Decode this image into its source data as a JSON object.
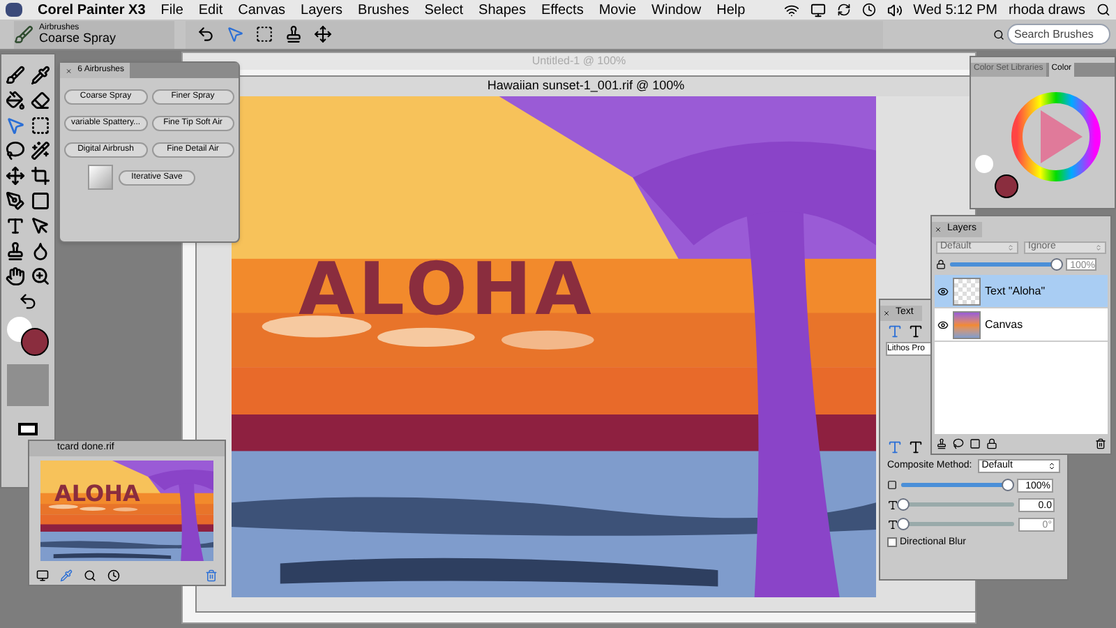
{
  "menu_bar": {
    "app_name": "Corel Painter X3",
    "menus": [
      "File",
      "Edit",
      "Canvas",
      "Layers",
      "Brushes",
      "Select",
      "Shapes",
      "Effects",
      "Movie",
      "Window",
      "Help"
    ],
    "clock": "Wed 5:12 PM",
    "user": "rhoda draws"
  },
  "property_bar": {
    "brush_category": "Airbrushes",
    "brush_variant": "Coarse Spray",
    "search": {
      "placeholder": "Search Brushes"
    }
  },
  "background_document": {
    "title": "Untitled-1 @ 100%"
  },
  "document": {
    "title": "Hawaiian sunset-1_001.rif @ 100%",
    "artwork_text": "ALOHA"
  },
  "brush_panel": {
    "title": "6 Airbrushes",
    "variants": [
      "Coarse Spray",
      "Finer Spray",
      "variable Spattery...",
      "Fine Tip Soft Air",
      "Digital Airbrush",
      "Fine Detail Air"
    ],
    "iterative_save": "Iterative Save"
  },
  "navigator": {
    "title": "tcard done.rif",
    "thumbnail_text": "ALOHA"
  },
  "color_panel": {
    "tabs": [
      {
        "label": "Color Set Libraries",
        "selected": false
      },
      {
        "label": "Color",
        "selected": true
      }
    ]
  },
  "layers_panel": {
    "title": "Layers",
    "composite_method": "Default",
    "composite_depth": "Ignore",
    "opacity": {
      "level": 0.95,
      "reading": "100%"
    },
    "layers": [
      {
        "name": "Text \"Aloha\"",
        "kind": "text",
        "selected": true
      },
      {
        "name": "Canvas",
        "kind": "image",
        "selected": false
      }
    ]
  },
  "text_panel": {
    "title": "Text",
    "font": "Lithos Pro",
    "composite_label": "Composite Method:",
    "composite_value": "Default",
    "opacity": {
      "level": 0.95,
      "reading": "100%"
    },
    "blur_amount": {
      "level": 0,
      "reading": "0.0"
    },
    "blur_angle": {
      "level": 0,
      "reading": "0°"
    },
    "directional_blur": {
      "label": "Directional Blur",
      "checked": false
    }
  }
}
